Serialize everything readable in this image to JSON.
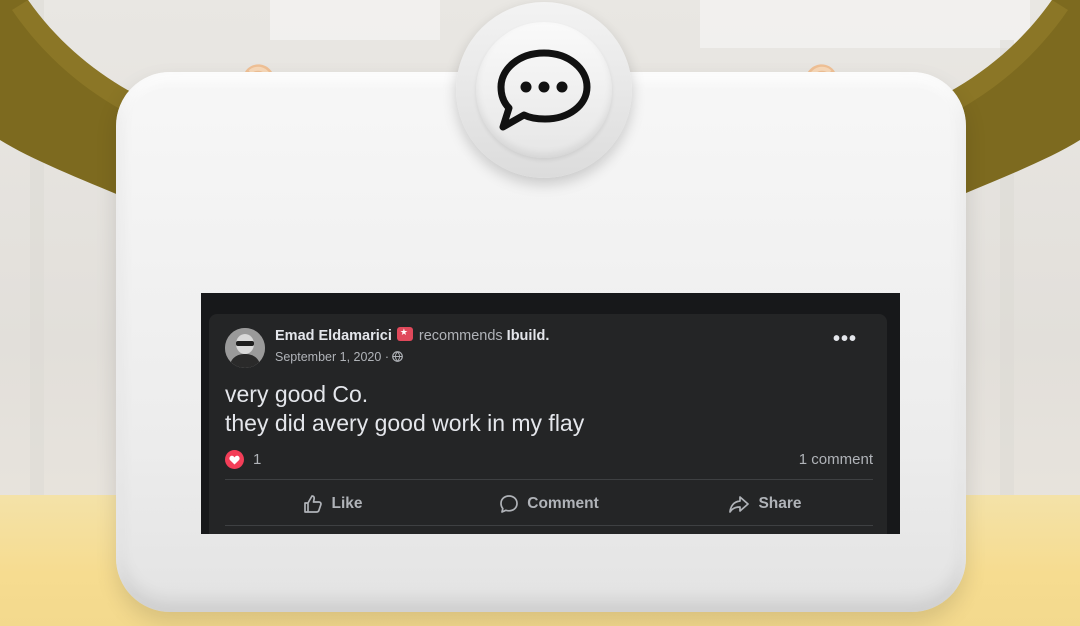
{
  "colors": {
    "post_background": "#242526",
    "post_text": "#e4e6eb",
    "secondary_text": "#b0b3b8",
    "reaction_heart": "#f33e58",
    "badge": "#e0495b",
    "sleeve": "#7d6a1f"
  },
  "header_icon": {
    "icon": "chat-bubble-dots-icon"
  },
  "post": {
    "author": "Emad Eldamarici",
    "author_badge_icon": "top-fan-badge-icon",
    "action_text": "recommends",
    "page_name": "Ibuild.",
    "date": "September 1, 2020",
    "separator": "·",
    "privacy_icon": "globe-icon",
    "more_icon": "more-options-icon",
    "more_label": "•••",
    "text_line_1": "very good Co.",
    "text_line_2": "they did avery good work in my flay",
    "reaction_icon": "heart-icon",
    "reaction_count": "1",
    "comment_count": "1 comment",
    "actions": [
      {
        "label": "Like",
        "icon": "like-icon"
      },
      {
        "label": "Comment",
        "icon": "comment-icon"
      },
      {
        "label": "Share",
        "icon": "share-icon"
      }
    ]
  }
}
